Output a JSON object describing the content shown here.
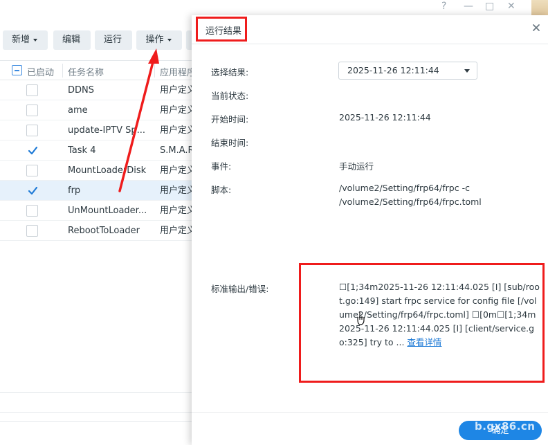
{
  "window": {
    "controls": [
      "?",
      "—",
      "□",
      "✕"
    ]
  },
  "toolbar": {
    "add_label": "新增",
    "edit_label": "编辑",
    "run_label": "运行",
    "action_label": "操作"
  },
  "grid": {
    "columns": [
      "已启动",
      "任务名称",
      "应用程序"
    ],
    "rows": [
      {
        "enabled": false,
        "name": "DDNS",
        "app": "用户定义"
      },
      {
        "enabled": false,
        "name": "ame",
        "app": "用户定义"
      },
      {
        "enabled": false,
        "name": "update-IPTV Sp...",
        "app": "用户定义"
      },
      {
        "enabled": true,
        "name": "Task 4",
        "app": "S.M.A.R"
      },
      {
        "enabled": false,
        "name": "MountLoaderDisk",
        "app": "用户定义"
      },
      {
        "enabled": true,
        "name": "frp",
        "app": "用户定义",
        "selected": true
      },
      {
        "enabled": false,
        "name": "UnMountLoader...",
        "app": "用户定义"
      },
      {
        "enabled": false,
        "name": "RebootToLoader",
        "app": "用户定义"
      }
    ]
  },
  "modal": {
    "title": "运行结果",
    "fields": {
      "select_result_label": "选择结果:",
      "select_result_value": "2025-11-26 12:11:44",
      "status_label": "当前状态:",
      "status_value": "",
      "start_label": "开始时间:",
      "start_value": "2025-11-26 12:11:44",
      "end_label": "结束时间:",
      "end_value": "",
      "event_label": "事件:",
      "event_value": "手动运行",
      "script_label": "脚本:",
      "script_value": "/volume2/Setting/frp64/frpc -c /volume2/Setting/frp64/frpc.toml",
      "stdout_label": "标准输出/错误:",
      "stdout_value": "☐[1;34m2025-11-26 12:11:44.025 [I] [sub/root.go:149] start frpc service for config file [/volume2/Setting/frp64/frpc.toml] ☐[0m☐[1;34m2025-11-26 12:11:44.025 [I] [client/service.go:325] try to ...",
      "details_link": "查看详情"
    },
    "ok_label": "确定"
  },
  "watermark": "b.gx86.cn",
  "colors": {
    "accent": "#1e86e5",
    "annotation": "#ef1c1c",
    "selected_row": "#e6f1fb"
  }
}
